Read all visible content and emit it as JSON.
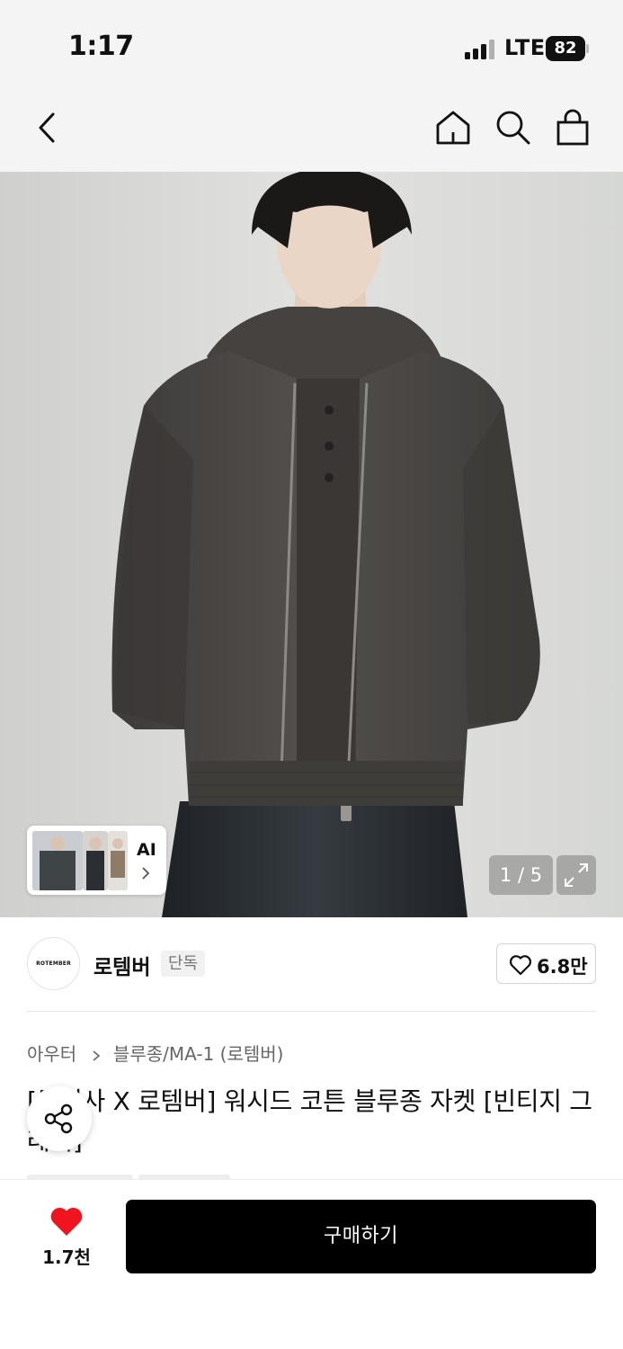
{
  "status_bar": {
    "time": "1:17",
    "network": "LTE",
    "battery": "82"
  },
  "nav": {
    "icons": [
      "back-arrow-icon",
      "home-icon",
      "search-icon",
      "shopping-bag-icon"
    ]
  },
  "gallery": {
    "ai_label": "AI",
    "counter": "1 / 5",
    "colors": {
      "wall": "#d9d9d6",
      "jacket": "#4a4845"
    }
  },
  "brand": {
    "logo_text": "ROTEMBER",
    "name": "로템버",
    "badge": "단독",
    "like_count": "6.8만"
  },
  "breadcrumb": {
    "category": "아우터",
    "subcategory": "블루종/MA-1 (로템버)"
  },
  "product": {
    "title": "[무신사 X 로템버] 워시드 코튼 블루종 자켓 [빈티지 그레이]"
  },
  "bottom_bar": {
    "wish_count": "1.7천",
    "buy_label": "구매하기",
    "wish_color": "#f0141e"
  }
}
